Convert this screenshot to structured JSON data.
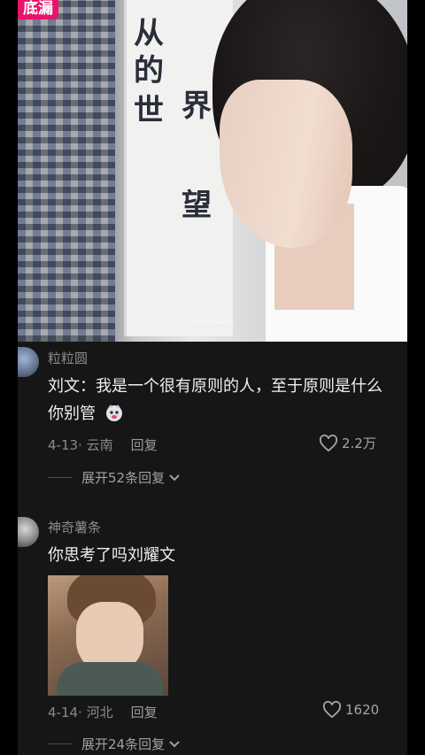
{
  "badge": "底漏",
  "video": {
    "poster_lines": [
      "从",
      "的",
      "世",
      "界",
      "望"
    ],
    "watermark": "ABOVGAWYE"
  },
  "comments": [
    {
      "username": "粒粒圆",
      "text_line1": "刘文：我是一个很有原则的人，至于原则是什么",
      "text_line2": "你别管",
      "date_location": "4-13· 云南",
      "reply": "回复",
      "likes": "2.2万",
      "expand": "展开52条回复"
    },
    {
      "username": "神奇薯条",
      "text_line1": "你思考了吗刘耀文",
      "date_location": "4-14· 河北",
      "reply": "回复",
      "likes": "1620",
      "expand": "展开24条回复"
    }
  ],
  "colors": {
    "badge_bg": "#e8136a",
    "panel_bg": "#161616",
    "text_primary": "#efefef",
    "text_secondary": "#8b8b8b"
  },
  "icons": [
    "heart-icon",
    "chevron-down-icon",
    "emoji-icon"
  ]
}
